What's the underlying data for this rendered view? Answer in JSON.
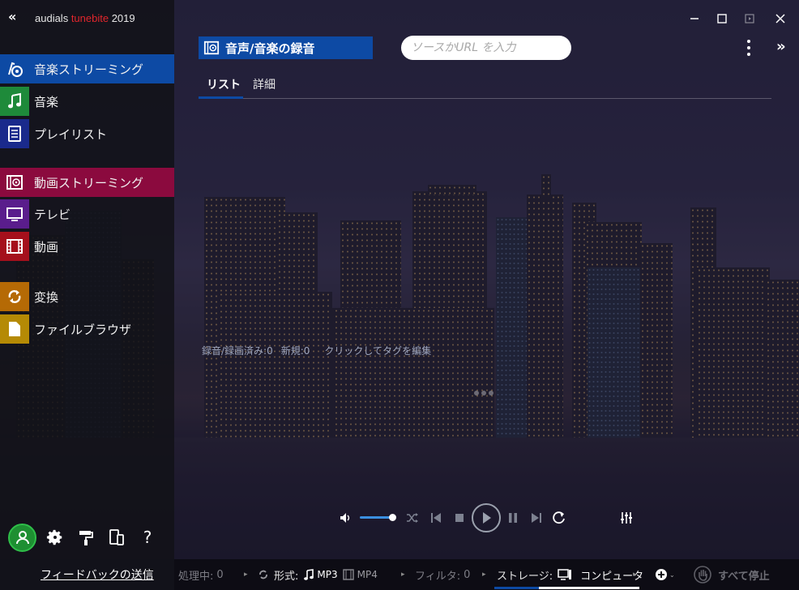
{
  "app": {
    "brand_prefix": "audials ",
    "brand_highlight": "tunebite",
    "brand_suffix": " 2019",
    "collapse_glyph": "«",
    "brand_accent": "#e0262c"
  },
  "window_controls": {
    "minimize": "—",
    "maximize": "☐",
    "restore": "▫",
    "close": "✕"
  },
  "sidebar": {
    "items": [
      {
        "label": "音楽ストリーミング",
        "icon": "music-streaming-icon",
        "color": "#0d4aa4"
      },
      {
        "label": "音楽",
        "icon": "music-note-icon",
        "color": "#1e8a3a"
      },
      {
        "label": "プレイリスト",
        "icon": "playlist-icon",
        "color": "#1a2a8c"
      },
      {
        "label": "動画ストリーミング",
        "icon": "video-streaming-icon",
        "color": "#8b0a3e"
      },
      {
        "label": "テレビ",
        "icon": "tv-icon",
        "color": "#5a1d8c"
      },
      {
        "label": "動画",
        "icon": "film-icon",
        "color": "#a5101c"
      },
      {
        "label": "変換",
        "icon": "convert-icon",
        "color": "#b56a05"
      },
      {
        "label": "ファイルブラウザ",
        "icon": "file-browser-icon",
        "color": "#b58a05"
      }
    ],
    "feedback": "フィードバックの送信"
  },
  "main": {
    "title": "音声/音楽の録音",
    "url_placeholder": "ソースかURL を入力",
    "expand_glyph": "»",
    "tabs": [
      {
        "label": "リスト",
        "active": true
      },
      {
        "label": "詳細",
        "active": false
      }
    ],
    "stats": {
      "recorded_label": "録音/録画済み:",
      "recorded_count": "0",
      "new_label": "新規:",
      "new_count": "0",
      "edit_tags": "クリックしてタグを編集"
    }
  },
  "player": {
    "volume_level": 0.9
  },
  "statusbar": {
    "processing_label": "処理中:",
    "processing_count": "0",
    "format_label": "形式:",
    "format_audio": "MP3",
    "format_video": "MP4",
    "filter_label": "フィルタ:",
    "filter_count": "0",
    "storage_label": "ストレージ:",
    "storage_value": "コンピュータ",
    "stop_all": "すべて停止"
  }
}
